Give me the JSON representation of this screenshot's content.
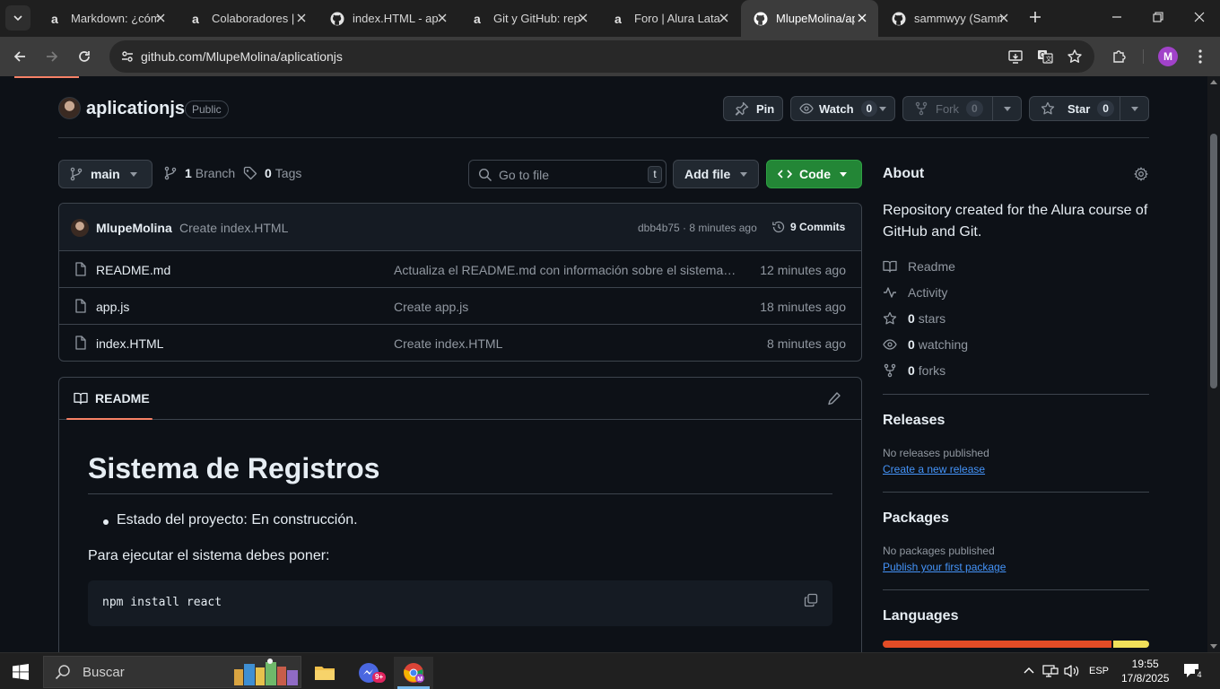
{
  "browser": {
    "tabs": [
      {
        "title": "Markdown: ¿cómo",
        "favicon": "alura-icon",
        "active": false
      },
      {
        "title": "Colaboradores |",
        "favicon": "alura-icon",
        "active": false
      },
      {
        "title": "index.HTML - ap",
        "favicon": "github-icon",
        "active": false
      },
      {
        "title": "Git y GitHub: rep",
        "favicon": "alura-icon",
        "active": false
      },
      {
        "title": "Foro | Alura Lata",
        "favicon": "alura-icon",
        "active": false
      },
      {
        "title": "MlupeMolina/ap",
        "favicon": "github-icon",
        "active": true
      },
      {
        "title": "sammwyy (Samm",
        "favicon": "github-icon",
        "active": false
      }
    ],
    "url": "github.com/MlupeMolina/aplicationjs",
    "profile_initial": "M"
  },
  "repo": {
    "name": "aplicationjs",
    "visibility": "Public",
    "pin_label": "Pin",
    "watch_label": "Watch",
    "watch_count": "0",
    "fork_label": "Fork",
    "fork_count": "0",
    "star_label": "Star",
    "star_count": "0"
  },
  "toolbar": {
    "branch": "main",
    "branch_count": "1",
    "branch_label": "Branch",
    "tag_count": "0",
    "tag_label": "Tags",
    "goto_placeholder": "Go to file",
    "goto_key": "t",
    "add_file_label": "Add file",
    "code_label": "Code"
  },
  "latest_commit": {
    "author": "MlupeMolina",
    "message": "Create index.HTML",
    "hash_time": "dbb4b75 · 8 minutes ago",
    "commits_label": "9 Commits"
  },
  "files": [
    {
      "name": "README.md",
      "message": "Actualiza el README.md con información sobre el sistema de registros",
      "date": "12 minutes ago"
    },
    {
      "name": "app.js",
      "message": "Create app.js",
      "date": "18 minutes ago"
    },
    {
      "name": "index.HTML",
      "message": "Create index.HTML",
      "date": "8 minutes ago"
    }
  ],
  "readme": {
    "tab_label": "README",
    "title": "Sistema de Registros",
    "bullet": "Estado del proyecto: En construcción.",
    "paragraph": "Para ejecutar el sistema debes poner:",
    "code": "npm install react"
  },
  "sidebar": {
    "about_title": "About",
    "description": "Repository created for the Alura course of GitHub and Git.",
    "readme_label": "Readme",
    "activity_label": "Activity",
    "stars_count": "0",
    "stars_label": "stars",
    "watching_count": "0",
    "watching_label": "watching",
    "forks_count": "0",
    "forks_label": "forks",
    "releases_title": "Releases",
    "releases_empty": "No releases published",
    "releases_link": "Create a new release",
    "packages_title": "Packages",
    "packages_empty": "No packages published",
    "packages_link": "Publish your first package",
    "languages_title": "Languages",
    "language_colors": [
      "#e34c26",
      "#f1e05a"
    ],
    "language_share": [
      86.3,
      13.7
    ]
  },
  "taskbar": {
    "search_label": "Buscar",
    "badge": "9+",
    "language": "ESP",
    "time": "19:55",
    "date": "17/8/2025",
    "notifications": "4"
  },
  "colors": {
    "accent_green": "#238636",
    "link_blue": "#4493f8",
    "underline_orange": "#f78166"
  }
}
